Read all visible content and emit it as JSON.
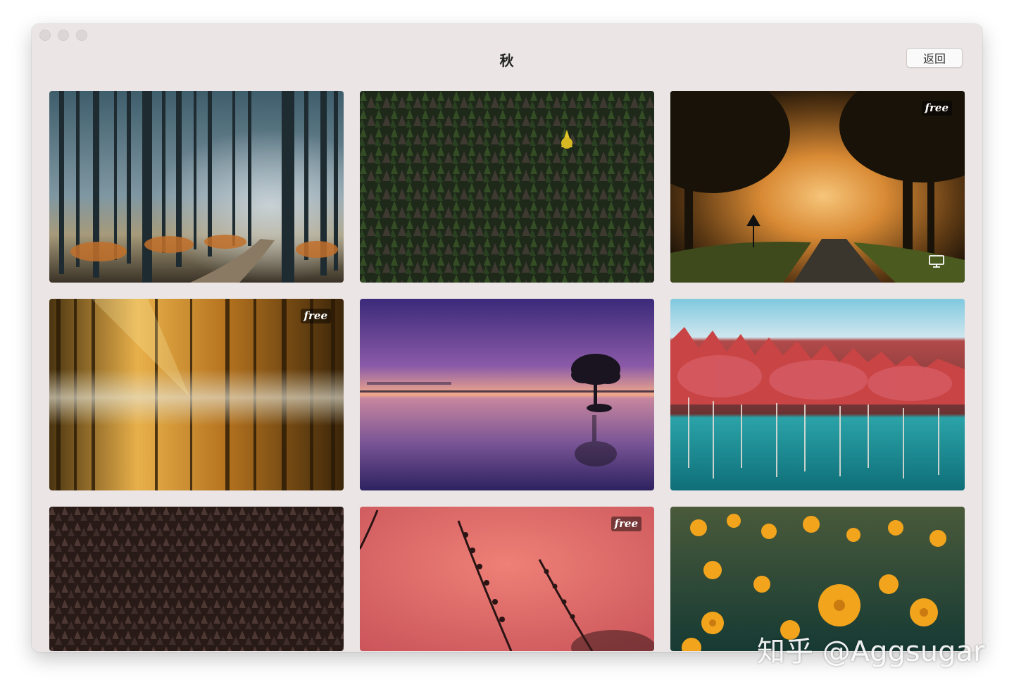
{
  "window": {
    "title": "秋",
    "back_label": "返回"
  },
  "tiles": [
    {
      "id": "misty-forest-path",
      "badge": ""
    },
    {
      "id": "green-forest-yellow-tree",
      "badge": ""
    },
    {
      "id": "golden-fog-road",
      "badge": "free",
      "desktop_icon": "monitor-icon"
    },
    {
      "id": "sunbeam-forest-reflection",
      "badge": "free"
    },
    {
      "id": "purple-lake-tree",
      "badge": ""
    },
    {
      "id": "red-larch-lake",
      "badge": ""
    },
    {
      "id": "dark-pine-forest",
      "badge": ""
    },
    {
      "id": "pink-sky-branches",
      "badge": "free"
    },
    {
      "id": "yellow-flowers",
      "badge": ""
    }
  ],
  "watermark": "知乎 @Aggsugar"
}
